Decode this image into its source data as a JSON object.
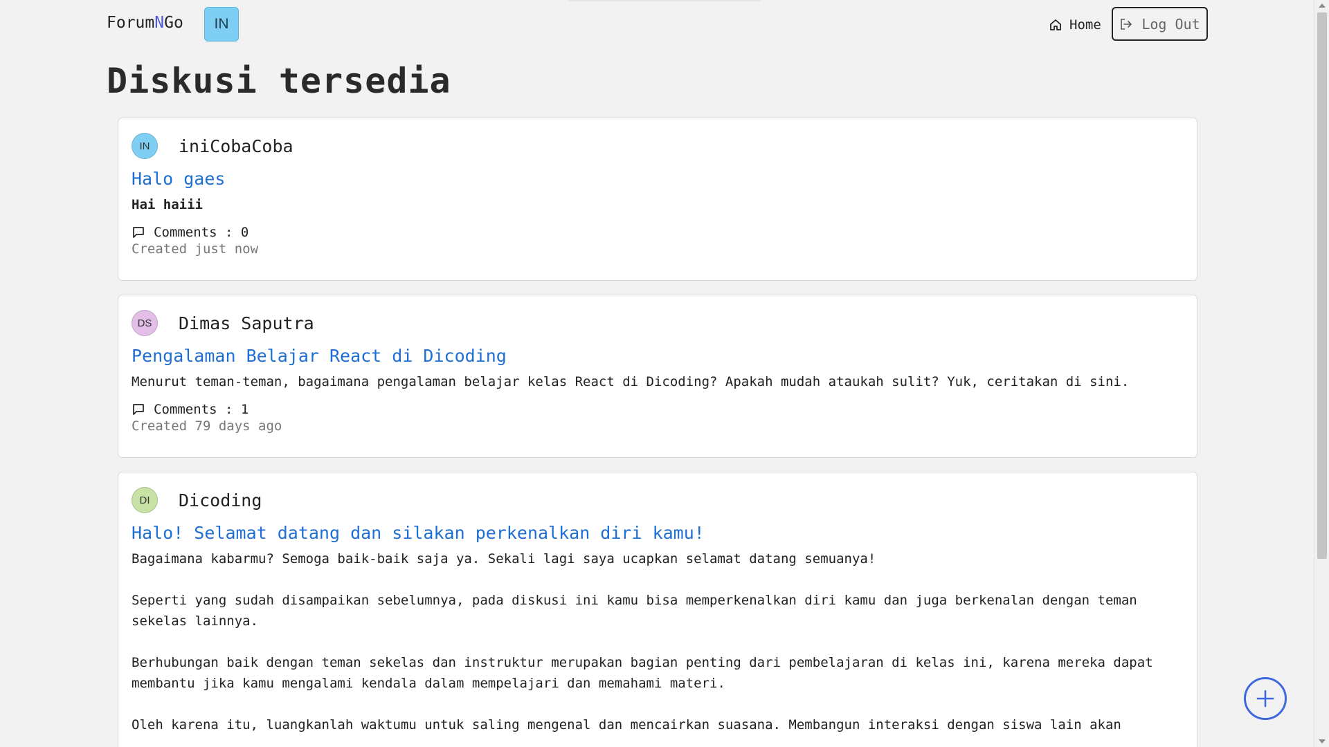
{
  "header": {
    "brand_prefix": "Forum",
    "brand_accent": "N",
    "brand_suffix": "Go",
    "user_initials": "IN",
    "home_label": "Home",
    "logout_label": "Log Out"
  },
  "page_title": "Diskusi tersedia",
  "threads": [
    {
      "author": "iniCobaCoba",
      "initials": "IN",
      "avatar_color": "#7ecff3",
      "title": "Halo gaes",
      "body": "Hai haiii",
      "comments": "Comments : 0",
      "created": "Created just now"
    },
    {
      "author": "Dimas Saputra",
      "initials": "DS",
      "avatar_color": "#e3bfe8",
      "title": "Pengalaman Belajar React di Dicoding",
      "body": "Menurut teman-teman, bagaimana pengalaman belajar kelas React di Dicoding? Apakah mudah ataukah sulit? Yuk, ceritakan di sini.",
      "comments": "Comments : 1",
      "created": "Created 79 days ago"
    },
    {
      "author": "Dicoding",
      "initials": "DI",
      "avatar_color": "#c7e2a4",
      "title": "Halo! Selamat datang dan silakan perkenalkan diri kamu!",
      "body": "Bagaimana kabarmu? Semoga baik-baik saja ya. Sekali lagi saya ucapkan selamat datang semuanya!\n\nSeperti yang sudah disampaikan sebelumnya, pada diskusi ini kamu bisa memperkenalkan diri kamu dan juga berkenalan dengan teman sekelas lainnya.\n\nBerhubungan baik dengan teman sekelas dan instruktur merupakan bagian penting dari pembelajaran di kelas ini, karena mereka dapat membantu jika kamu mengalami kendala dalam mempelajari dan memahami materi.\n\nOleh karena itu, luangkanlah waktumu untuk saling mengenal dan mencairkan suasana. Membangun interaksi dengan siswa lain akan",
      "comments": "",
      "created": ""
    }
  ],
  "icons": {
    "home": "home-icon",
    "logout": "logout-icon",
    "comment": "comment-icon",
    "add": "plus-icon"
  },
  "colors": {
    "accent_link": "#1d6fd6",
    "brand_accent": "#4f5bd5",
    "fab": "#3f67e0"
  }
}
